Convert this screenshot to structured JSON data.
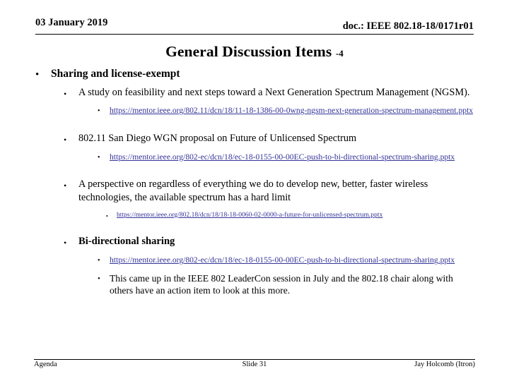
{
  "header": {
    "date": "03 January 2019",
    "doc": "doc.: IEEE 802.18-18/0171r01"
  },
  "title": {
    "main": "General Discussion Items ",
    "suffix": "-4"
  },
  "colors": {
    "link": "#333399",
    "text": "#000000",
    "background": "#ffffff"
  },
  "bullets": {
    "level1_glyph": "•",
    "level2_glyph": "•",
    "level3_glyph": "•"
  },
  "content": {
    "topic": "Sharing and license-exempt",
    "item1": {
      "text": "A study on feasibility and next steps toward a Next Generation Spectrum Management (NGSM).",
      "link": "https://mentor.ieee.org/802.11/dcn/18/11-18-1386-00-0wng-ngsm-next-generation-spectrum-management.pptx"
    },
    "item2": {
      "text": "802.11 San Diego WGN proposal on Future of Unlicensed Spectrum",
      "link": "https://mentor.ieee.org/802-ec/dcn/18/ec-18-0155-00-00EC-push-to-bi-directional-spectrum-sharing.pptx"
    },
    "item3": {
      "text": "A perspective on regardless of everything we do to develop new, better, faster wireless technologies, the available spectrum has a hard limit",
      "link": "https://mentor.ieee.org/802.18/dcn/18/18-18-0060-02-0000-a-future-for-unlicensed-spectrum.pptx"
    },
    "item4": {
      "text": "Bi-directional sharing",
      "link": "https://mentor.ieee.org/802-ec/dcn/18/ec-18-0155-00-00EC-push-to-bi-directional-spectrum-sharing.pptx",
      "note": "This came up in the IEEE 802 LeaderCon session in July and the 802.18 chair along with others have an action item to look at this more."
    }
  },
  "footer": {
    "left": "Agenda",
    "center": "Slide 31",
    "right": "Jay Holcomb (Itron)"
  }
}
